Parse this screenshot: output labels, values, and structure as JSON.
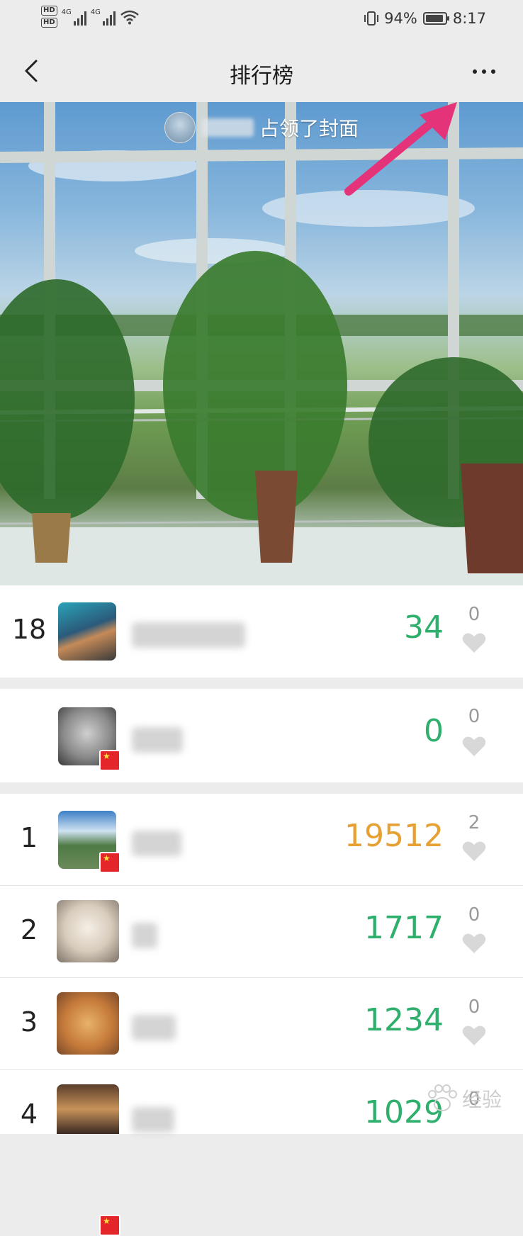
{
  "status_bar": {
    "hd1": "HD",
    "hd2": "HD",
    "net1": "4G",
    "net2": "4G",
    "battery_pct": "94%",
    "battery_level": 0.94,
    "time": "8:17"
  },
  "title_bar": {
    "title": "排行榜"
  },
  "cover": {
    "banner_text": "占领了封面"
  },
  "leaderboard": {
    "my_rank": {
      "rank": "18",
      "score": "34",
      "likes": "0"
    },
    "second_entry": {
      "rank": "",
      "score": "0",
      "likes": "0"
    },
    "entries": [
      {
        "rank": "1",
        "score": "19512",
        "likes": "2"
      },
      {
        "rank": "2",
        "score": "1717",
        "likes": "0"
      },
      {
        "rank": "3",
        "score": "1234",
        "likes": "0"
      },
      {
        "rank": "4",
        "score": "1029",
        "likes": "0"
      }
    ]
  },
  "colors": {
    "score_green": "#2eaf6b",
    "score_gold": "#e6a033",
    "arrow_pink": "#e5337a"
  },
  "watermark": {
    "text": "经验"
  }
}
